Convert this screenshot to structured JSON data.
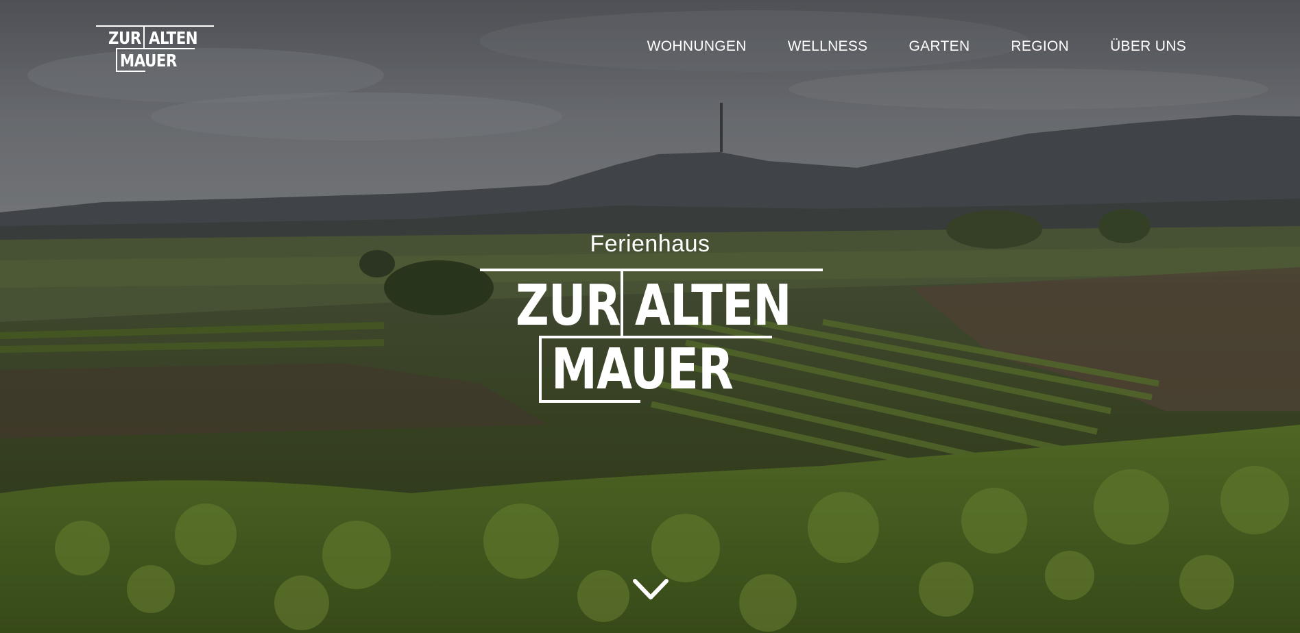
{
  "logo": {
    "line1_word1": "ZUR",
    "line1_word2": "ALTEN",
    "line2": "MAUER"
  },
  "nav": {
    "items": [
      {
        "label": "WOHNUNGEN"
      },
      {
        "label": "WELLNESS"
      },
      {
        "label": "GARTEN"
      },
      {
        "label": "REGION"
      },
      {
        "label": "ÜBER UNS"
      }
    ]
  },
  "hero": {
    "subtitle": "Ferienhaus",
    "title_word1": "ZUR",
    "title_word2": "ALTEN",
    "title_line2": "MAUER"
  },
  "icons": {
    "scroll_down": "chevron-down-icon"
  },
  "colors": {
    "text": "#ffffff",
    "sky": "#6f7278",
    "vineyard_green": "#4f6a2a"
  }
}
